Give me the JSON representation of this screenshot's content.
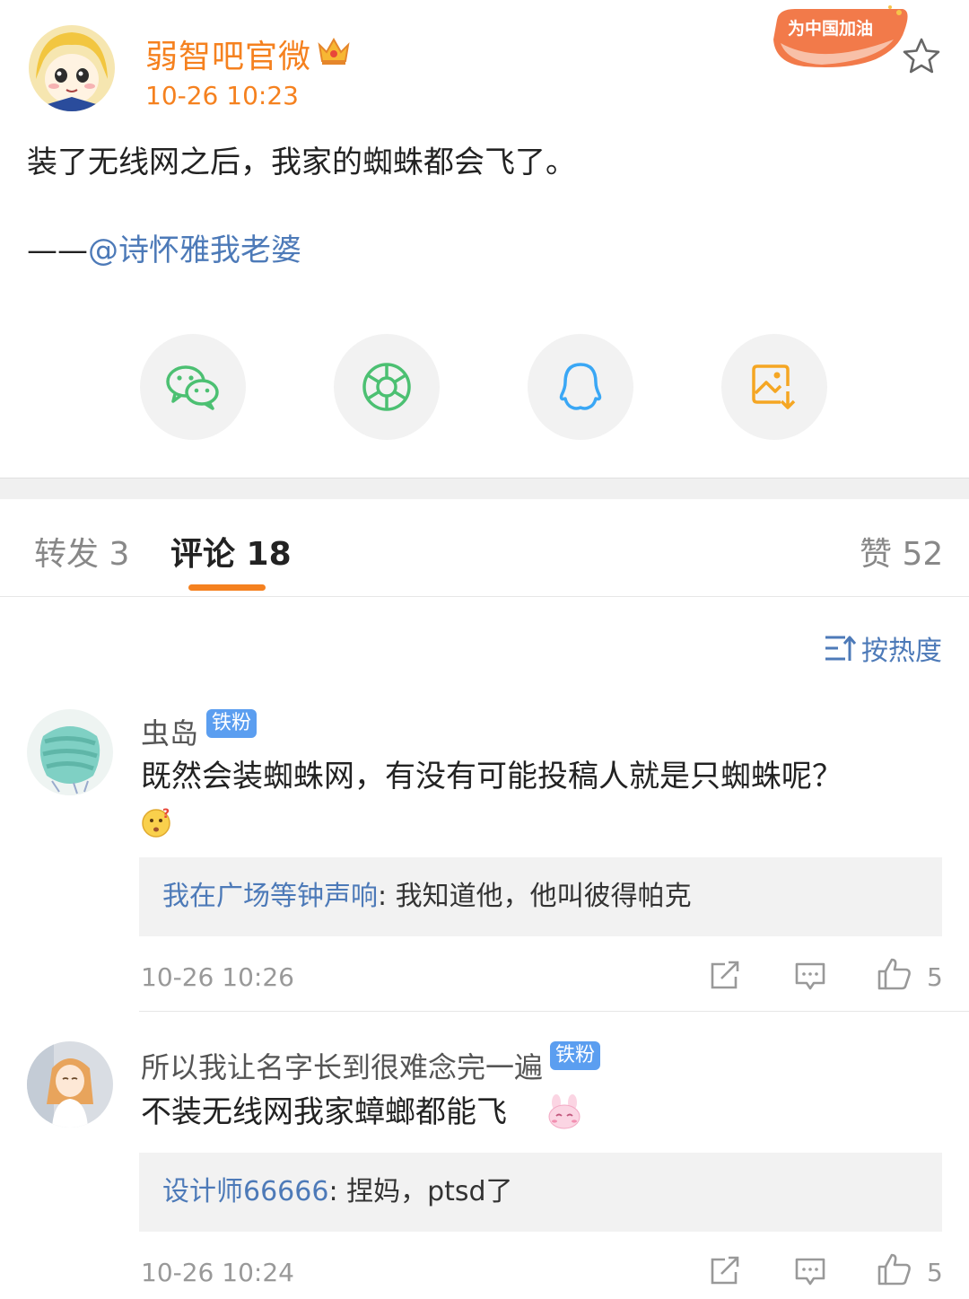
{
  "post": {
    "author": "弱智吧官微",
    "time": "10-26 10:23",
    "text": "装了无线网之后，我家的蜘蛛都会飞了。",
    "attribution_prefix": "——",
    "attribution_mention": "@诗怀雅我老婆",
    "promo_badge": "为中国加油"
  },
  "share": [
    {
      "name": "wechat-icon",
      "color": "#4cc072"
    },
    {
      "name": "moments-icon",
      "color": "#4cc072"
    },
    {
      "name": "qq-icon",
      "color": "#3aa7f5"
    },
    {
      "name": "save-image-icon",
      "color": "#f5a623"
    }
  ],
  "tabs": {
    "repost": "转发 3",
    "comments": "评论 18",
    "likes": "赞 52"
  },
  "sort_label": "按热度",
  "comments": [
    {
      "name": "虫岛",
      "badge": "铁粉",
      "text": "既然会装蜘蛛网，有没有可能投稿人就是只蜘蛛呢？",
      "emoji": "thinking-emoji",
      "reply_user": "我在广场等钟声响",
      "reply_text": ": 我知道他，他叫彼得帕克",
      "time": "10-26 10:26",
      "likes": "5"
    },
    {
      "name": "所以我让名字长到很难念完一遍",
      "badge": "铁粉",
      "text": "不装无线网我家蟑螂都能飞",
      "emoji": "bunny-emoji",
      "reply_user": "设计师66666",
      "reply_text": ": 捏妈，ptsd了",
      "time": "10-26 10:24",
      "likes": "5"
    }
  ],
  "colors": {
    "accent": "#f5811f",
    "link": "#4d7ab8",
    "fan_badge": "#5b9ef0"
  }
}
